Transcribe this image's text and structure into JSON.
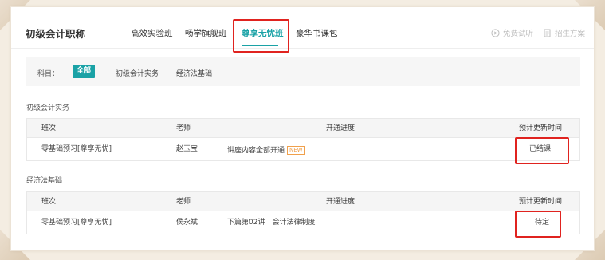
{
  "header": {
    "brand": "初级会计职称",
    "tabs": [
      {
        "label": "高效实验班",
        "active": false
      },
      {
        "label": "畅学旗舰班",
        "active": false
      },
      {
        "label": "尊享无忧班",
        "active": true
      },
      {
        "label": "豪华书课包",
        "active": false
      }
    ],
    "free_trial": "免费试听",
    "admission_plan": "招生方案"
  },
  "filter": {
    "label": "科目：",
    "options": [
      {
        "label": "全部",
        "active": true
      },
      {
        "label": "初级会计实务",
        "active": false
      },
      {
        "label": "经济法基础",
        "active": false
      }
    ]
  },
  "columns": [
    "班次",
    "老师",
    "开通进度",
    "预计更新时间"
  ],
  "sections": [
    {
      "title": "初级会计实务",
      "rows": [
        {
          "class_name": "零基础预习[尊享无忧]",
          "teacher": "赵玉宝",
          "progress": "讲座内容全部开通",
          "badge": "NEW",
          "update_time": "已结课"
        }
      ]
    },
    {
      "title": "经济法基础",
      "rows": [
        {
          "class_name": "零基础预习[尊享无忧]",
          "teacher": "侯永斌",
          "progress": "下篇第02讲　会计法律制度",
          "badge": "",
          "update_time": "待定"
        }
      ]
    }
  ],
  "colors": {
    "accent": "#1aa2a6",
    "highlight": "#e0231f",
    "new_badge": "#f0a04b"
  },
  "icons": [
    "play-circle-icon",
    "document-icon"
  ]
}
